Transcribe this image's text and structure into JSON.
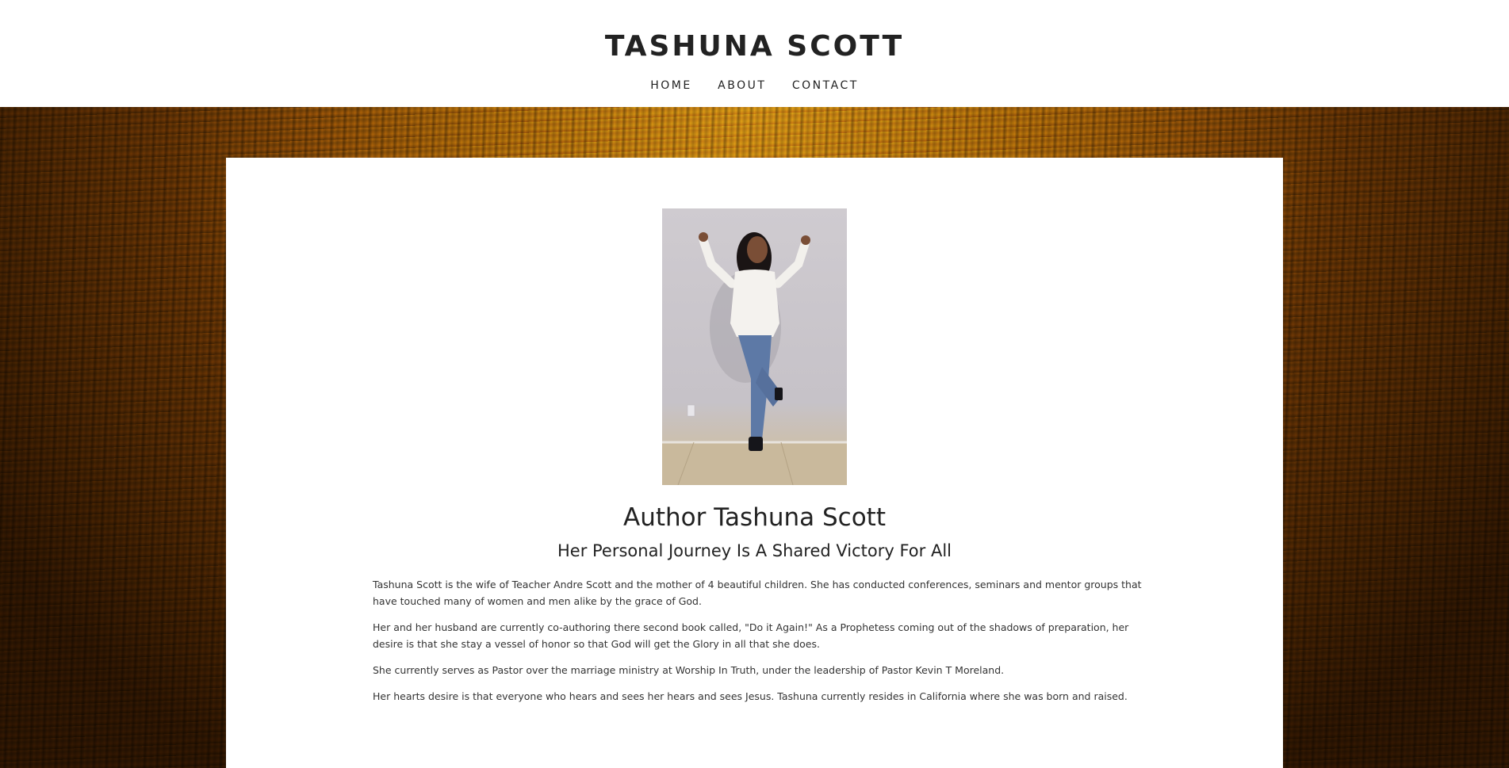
{
  "header": {
    "site_title": "TASHUNA SCOTT",
    "nav": [
      "HOME",
      "ABOUT",
      "CONTACT"
    ]
  },
  "main": {
    "heading": "Author Tashuna Scott",
    "subheading": "Her Personal Journey Is A Shared Victory For All",
    "paragraphs": [
      "Tashuna Scott is the wife of Teacher Andre Scott and the mother of 4 beautiful children. She has conducted conferences, seminars and mentor groups that have touched many of women and men alike by the grace of God.",
      "Her and her husband are currently co-authoring there second book called, \"Do it Again!\" As a Prophetess coming out of the shadows of preparation, her desire is that she stay a vessel of honor so that God will get the Glory in all that she does.",
      "She currently serves as Pastor over the marriage ministry at Worship In Truth, under the leadership of Pastor Kevin T Moreland.",
      "Her hearts desire is that everyone who hears and sees her hears and sees Jesus. Tashuna currently resides in California where she was born and raised."
    ]
  },
  "colors": {
    "background_texture": "#b3791a",
    "text": "#222222",
    "card": "#ffffff"
  }
}
